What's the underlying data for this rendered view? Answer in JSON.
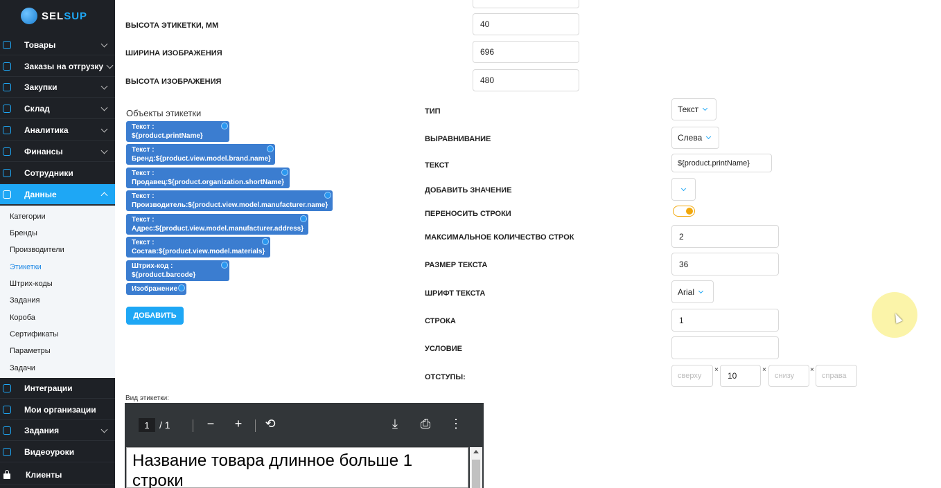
{
  "brand": {
    "logo_prefix": "SEL",
    "logo_suffix": "SUP",
    "accent": "#1ea7f5",
    "sidebar_bg": "#1e2126"
  },
  "sidebar": {
    "items": [
      {
        "label": "Товары",
        "icon": "bag-icon"
      },
      {
        "label": "Заказы на отгрузку",
        "icon": "orders-icon"
      },
      {
        "label": "Закупки",
        "icon": "cart-icon"
      },
      {
        "label": "Склад",
        "icon": "warehouse-icon"
      },
      {
        "label": "Аналитика",
        "icon": "chart-icon"
      },
      {
        "label": "Финансы",
        "icon": "wallet-icon"
      },
      {
        "label": "Сотрудники",
        "icon": "user-icon"
      },
      {
        "label": "Данные",
        "icon": "data-icon"
      }
    ],
    "sub_items": [
      "Категории",
      "Бренды",
      "Производители",
      "Этикетки",
      "Штрих-коды",
      "Задания",
      "Короба",
      "Сертификаты",
      "Параметры",
      "Задачи"
    ],
    "bottom_items": [
      {
        "label": "Интеграции",
        "icon": "integrations-icon"
      },
      {
        "label": "Мои организации",
        "icon": "building-icon"
      },
      {
        "label": "Задания",
        "icon": "tasks-icon"
      },
      {
        "label": "Видеоуроки",
        "icon": "video-icon"
      },
      {
        "label": "Клиенты",
        "icon": "lock-icon"
      }
    ]
  },
  "label_dims": {
    "height_label": "ВЫСОТА ЭТИКЕТКИ, ММ",
    "height_value": "40",
    "img_width_label": "ШИРИНА ИЗОБРАЖЕНИЯ",
    "img_width_value": "696",
    "img_height_label": "ВЫСОТА ИЗОБРАЖЕНИЯ",
    "img_height_value": "480"
  },
  "objects": {
    "title": "Объекты этикетки",
    "chips": [
      {
        "line1": "Текст :",
        "line2": "${product.printName}"
      },
      {
        "line1": "Текст :",
        "line2": "Бренд:${product.view.model.brand.name}"
      },
      {
        "line1": "Текст :",
        "line2": "Продавец:${product.organization.shortName}"
      },
      {
        "line1": "Текст :",
        "line2": "Производитель:${product.view.model.manufacturer.name}"
      },
      {
        "line1": "Текст :",
        "line2": "Адрес:${product.view.model.manufacturer.address}"
      },
      {
        "line1": "Текст :",
        "line2": "Состав:${product.view.model.materials}"
      },
      {
        "line1": "Штрих-код :",
        "line2": "${product.barcode}"
      },
      {
        "line1": "Изображение",
        "line2": ""
      }
    ],
    "add_label": "ДОБАВИТЬ"
  },
  "props": {
    "type_label": "ТИП",
    "type_value": "Текст",
    "align_label": "ВЫРАВНИВАНИЕ",
    "align_value": "Слева",
    "text_label": "ТЕКСТ",
    "text_value": "${product.printName}",
    "add_value_label": "ДОБАВИТЬ ЗНАЧЕНИЕ",
    "wrap_label": "ПЕРЕНОСИТЬ СТРОКИ",
    "wrap_on": true,
    "max_lines_label": "МАКСИМАЛЬНОЕ КОЛИЧЕСТВО СТРОК",
    "max_lines_value": "2",
    "text_size_label": "РАЗМЕР ТЕКСТА",
    "text_size_value": "36",
    "font_label": "ШРИФТ ТЕКСТА",
    "font_value": "Arial",
    "row_label": "СТРОКА",
    "row_value": "1",
    "condition_label": "УСЛОВИЕ",
    "condition_value": "",
    "margins_label": "ОТСТУПЫ:",
    "margin_top_ph": "сверху",
    "margin_left_value": "10",
    "margin_bottom_ph": "снизу",
    "margin_right_ph": "справа",
    "times": "×"
  },
  "preview": {
    "label": "Вид этикетки:",
    "page_current": "1",
    "page_total": "/ 1",
    "doc_text": "Название товара длинное больше 1 строки"
  }
}
